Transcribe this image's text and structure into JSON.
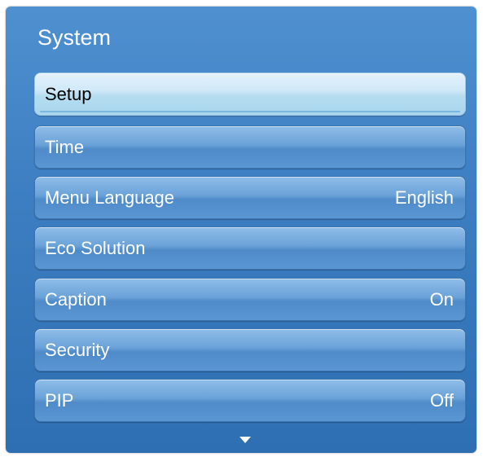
{
  "panel": {
    "title": "System",
    "items": [
      {
        "label": "Setup",
        "value": "",
        "selected": true
      },
      {
        "label": "Time",
        "value": ""
      },
      {
        "label": "Menu Language",
        "value": "English"
      },
      {
        "label": "Eco Solution",
        "value": ""
      },
      {
        "label": "Caption",
        "value": "On"
      },
      {
        "label": "Security",
        "value": ""
      },
      {
        "label": "PIP",
        "value": "Off"
      }
    ],
    "scroll_indicator_icon": "triangle-down-icon"
  },
  "colors": {
    "panel_blue": "#3d7fc2",
    "selected_highlight": "#d2e9f8",
    "text_white": "#ffffff"
  }
}
